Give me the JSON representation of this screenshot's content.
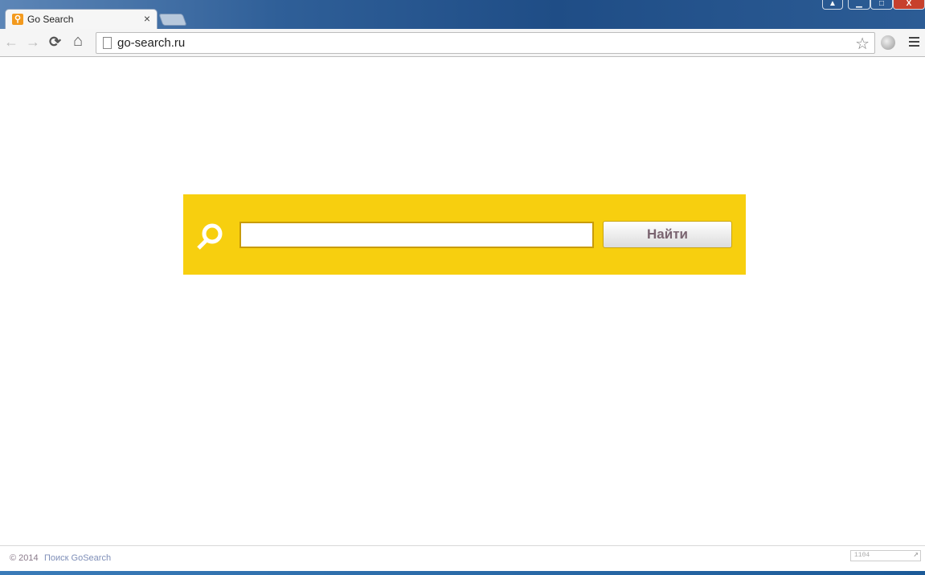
{
  "browser": {
    "tab": {
      "title": "Go Search",
      "favicon": "search-favicon",
      "close": "×"
    },
    "address": {
      "url": "go-search.ru"
    },
    "icons": {
      "back": "←",
      "forward": "→",
      "reload": "⟳",
      "home": "⌂",
      "star": "☆"
    },
    "window_buttons": {
      "user": "▲",
      "minimize": "▁",
      "maximize": "□",
      "close": "X"
    }
  },
  "search": {
    "query": "",
    "button_label": "Найти",
    "accent": "#f7cf0f"
  },
  "footer": {
    "copyright": "© 2014",
    "link": "Поиск GoSearch",
    "counter": "1104",
    "counter_arrow": "↗"
  }
}
